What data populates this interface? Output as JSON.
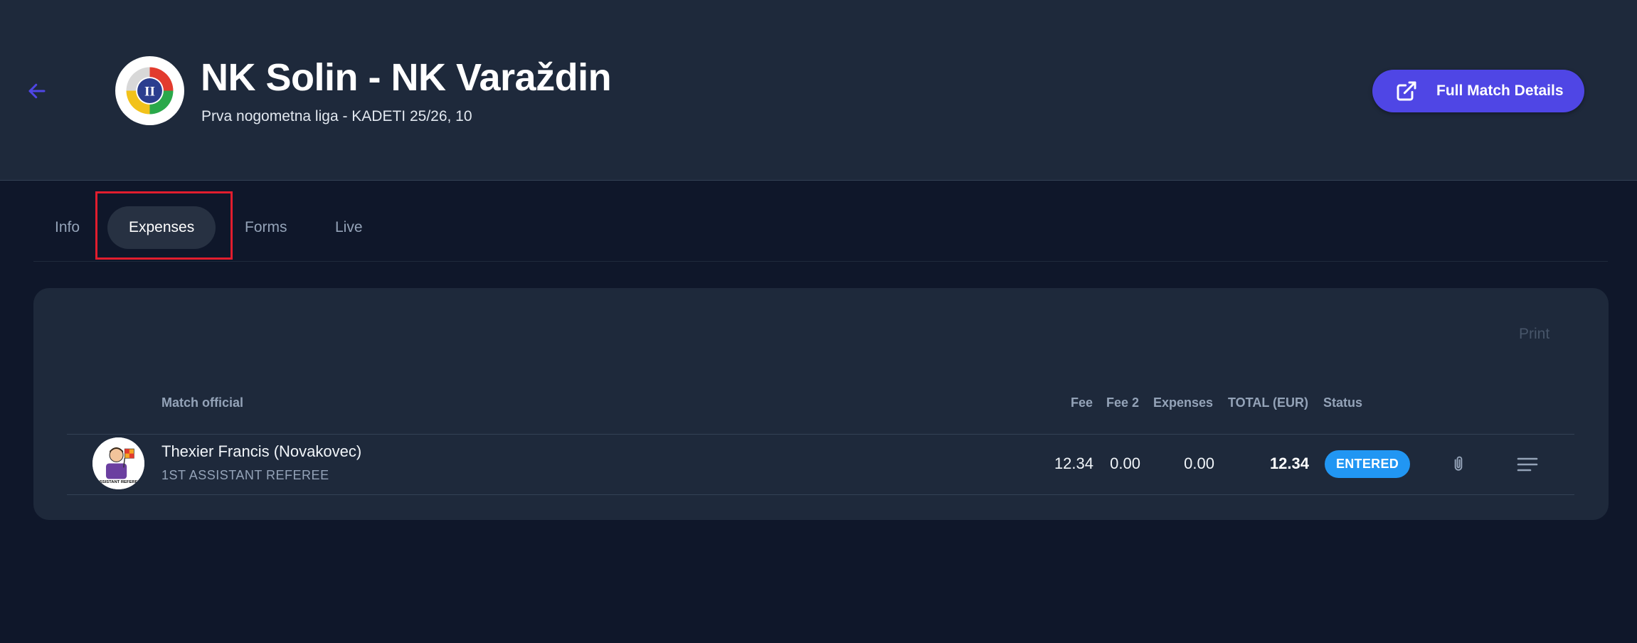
{
  "header": {
    "title": "NK Solin - NK Varaždin",
    "subtitle": "Prva nogometna liga - KADETI 25/26, 10",
    "full_details_label": "Full Match Details",
    "logo_text": "II"
  },
  "tabs": [
    {
      "label": "Info",
      "active": false
    },
    {
      "label": "Expenses",
      "active": true
    },
    {
      "label": "Forms",
      "active": false
    },
    {
      "label": "Live",
      "active": false
    }
  ],
  "expenses": {
    "print_label": "Print",
    "columns": {
      "official": "Match official",
      "fee": "Fee",
      "fee2": "Fee 2",
      "expenses": "Expenses",
      "total": "TOTAL (EUR)",
      "status": "Status"
    },
    "rows": [
      {
        "name": "Thexier Francis (Novakovec)",
        "role": "1ST ASSISTANT REFEREE",
        "avatar_text": "ASSISTANT REFEREE",
        "fee": "12.34",
        "fee2": "0.00",
        "expenses": "0.00",
        "total": "12.34",
        "status": "ENTERED"
      }
    ]
  },
  "colors": {
    "background": "#0f172a",
    "header_bg": "#1e293b",
    "accent": "#4f46e5",
    "status_entered": "#2196f3",
    "highlight": "#e11d2e"
  },
  "icons": {
    "back": "arrow-left-icon",
    "external": "external-link-icon",
    "attachment": "paperclip-icon",
    "menu": "menu-lines-icon"
  }
}
